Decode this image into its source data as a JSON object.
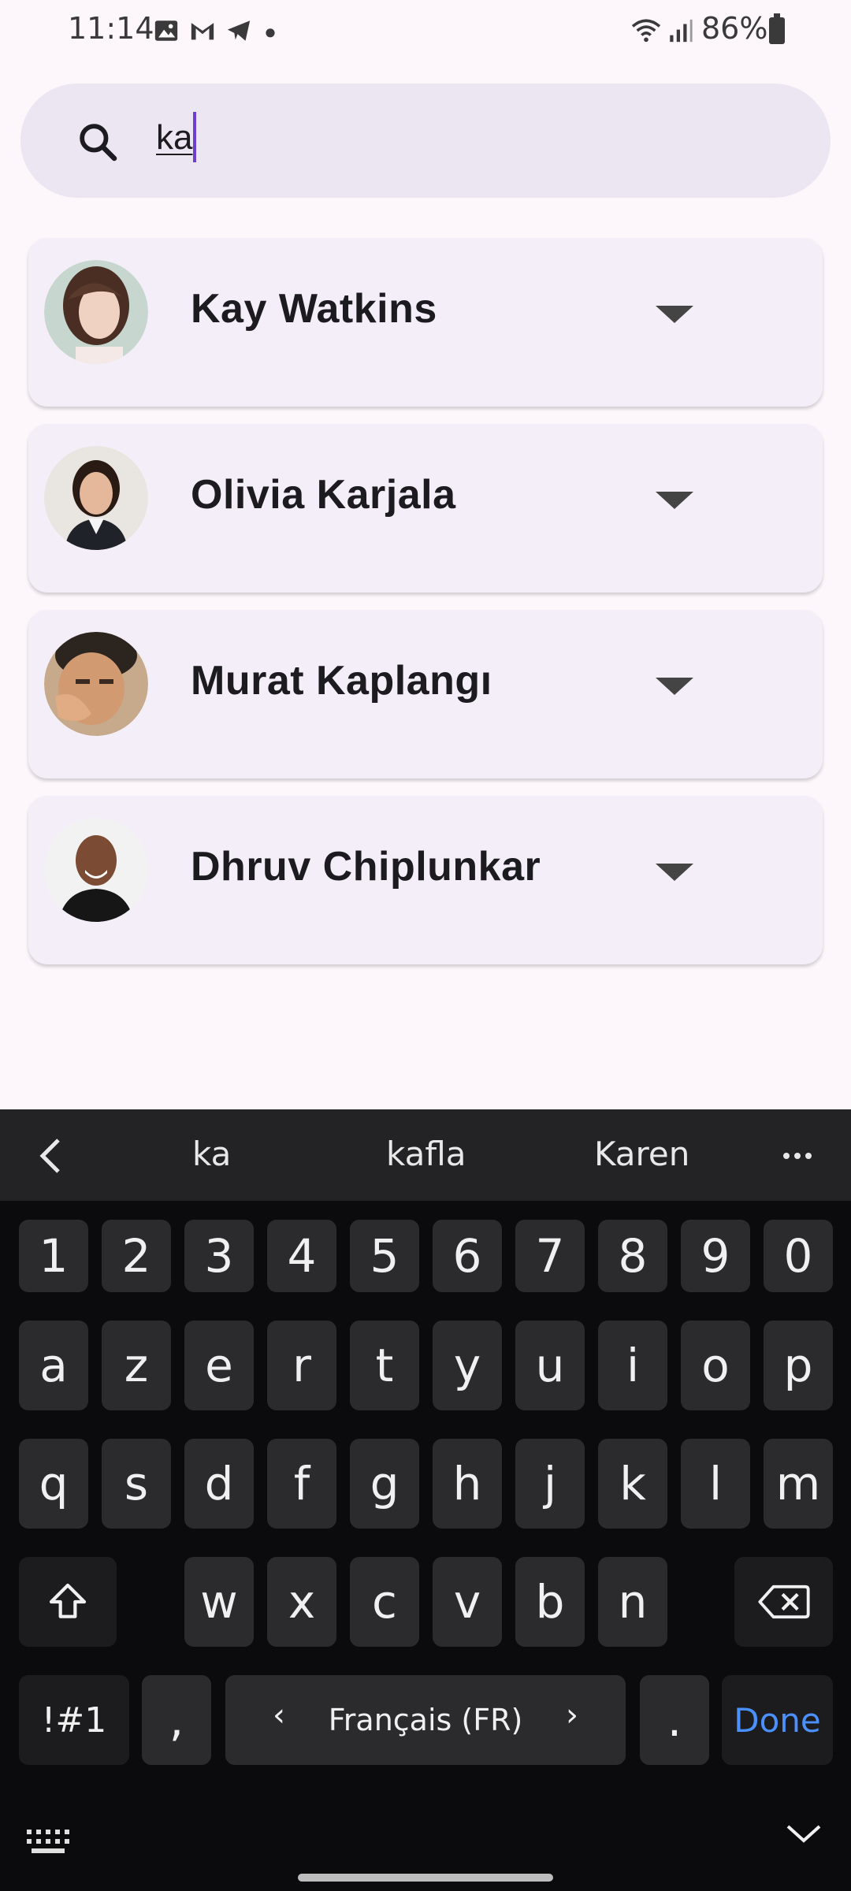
{
  "status_bar": {
    "time": "11:14",
    "battery": "86%",
    "icons": [
      "image-icon",
      "gmail-icon",
      "telegram-icon",
      "dot-icon",
      "wifi-icon",
      "signal-icon",
      "battery-icon"
    ]
  },
  "search": {
    "value": "ka",
    "icon": "search-icon"
  },
  "contacts": [
    {
      "name": "Kay Watkins"
    },
    {
      "name": "Olivia Karjala"
    },
    {
      "name": "Murat Kaplangı"
    },
    {
      "name": "Dhruv Chiplunkar"
    }
  ],
  "keyboard": {
    "suggestions": [
      "ka",
      "kafla",
      "Karen"
    ],
    "row_numbers": [
      "1",
      "2",
      "3",
      "4",
      "5",
      "6",
      "7",
      "8",
      "9",
      "0"
    ],
    "row1": [
      "a",
      "z",
      "e",
      "r",
      "t",
      "y",
      "u",
      "i",
      "o",
      "p"
    ],
    "row2": [
      "q",
      "s",
      "d",
      "f",
      "g",
      "h",
      "j",
      "k",
      "l",
      "m"
    ],
    "row3": [
      "w",
      "x",
      "c",
      "v",
      "b",
      "n"
    ],
    "symbols_key": "!#1",
    "comma_key": ",",
    "language": "Français (FR)",
    "period_key": ".",
    "done_key": "Done"
  },
  "colors": {
    "background": "#fdf7fb",
    "search_bg": "#ece6f3",
    "card_bg": "#f4eef8",
    "cursor": "#6b3fcf",
    "keyboard_bg": "#0b0b0d",
    "key_bg": "#2b2b2e",
    "done": "#4a90ff"
  }
}
